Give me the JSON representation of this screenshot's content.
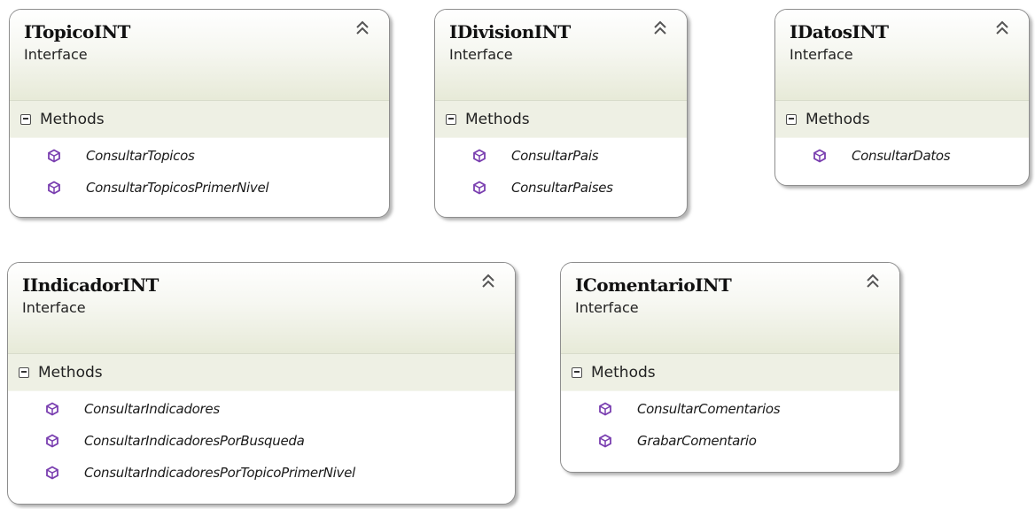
{
  "diagram": {
    "compartment_label": "Methods",
    "stereotype": "Interface",
    "interfaces": [
      {
        "name": "ITopicoINT",
        "methods": [
          "ConsultarTopicos",
          "ConsultarTopicosPrimerNivel"
        ]
      },
      {
        "name": "IDivisionINT",
        "methods": [
          "ConsultarPais",
          "ConsultarPaises"
        ]
      },
      {
        "name": "IDatosINT",
        "methods": [
          "ConsultarDatos"
        ]
      },
      {
        "name": "IIndicadorINT",
        "methods": [
          "ConsultarIndicadores",
          "ConsultarIndicadoresPorBusqueda",
          "ConsultarIndicadoresPorTopicoPrimerNivel"
        ]
      },
      {
        "name": "IComentarioINT",
        "methods": [
          "ConsultarComentarios",
          "GrabarComentario"
        ]
      }
    ],
    "colors": {
      "border": "#8e8e8e",
      "header_gradient_end": "#e7ead8",
      "compartment_bg": "#eef0e4",
      "method_icon": "#7a3fb0"
    },
    "icons": {
      "collapse": "double-chevron-up-icon",
      "compartment_toggle": "minus-box-icon",
      "method": "method-cube-icon"
    }
  }
}
